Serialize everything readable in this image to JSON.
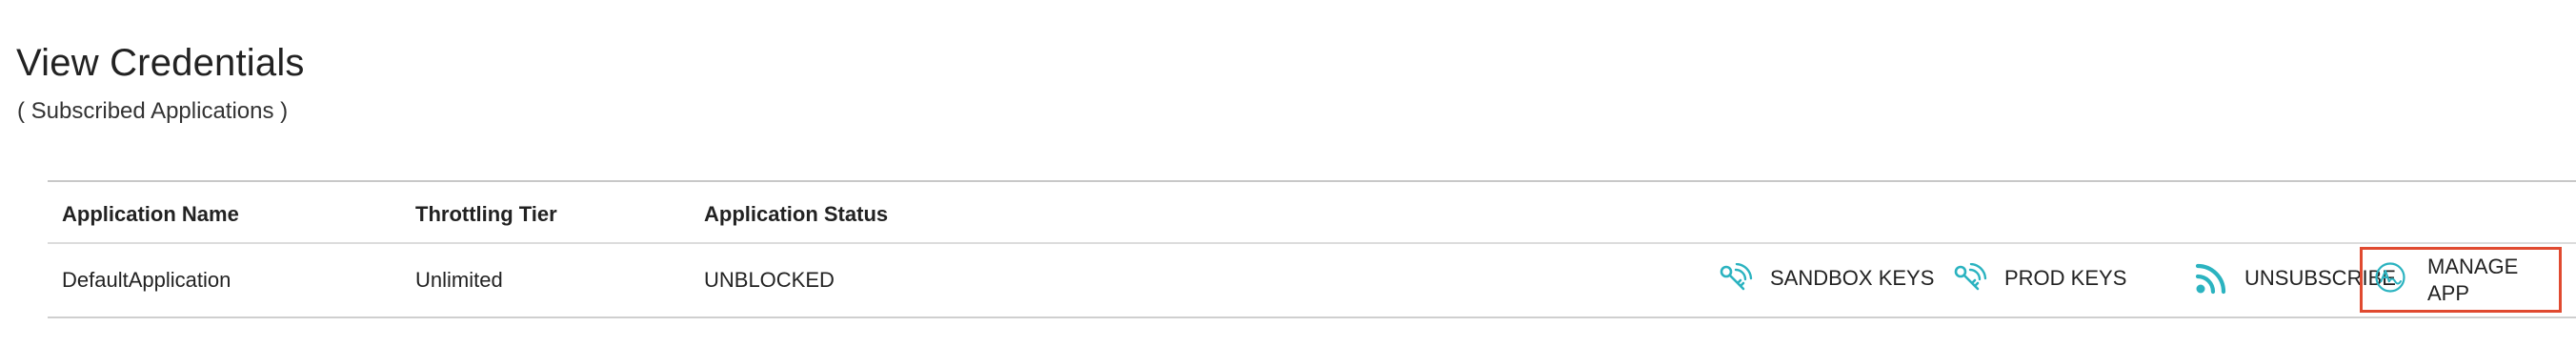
{
  "page": {
    "title": "View Credentials",
    "subtitle": "( Subscribed Applications )"
  },
  "table": {
    "headers": {
      "app_name": "Application Name",
      "tier": "Throttling Tier",
      "status": "Application Status"
    },
    "rows": [
      {
        "app_name": "DefaultApplication",
        "tier": "Unlimited",
        "status": "UNBLOCKED",
        "actions": {
          "sandbox_keys": {
            "label": "SANDBOX KEYS",
            "icon": "key-wave-icon"
          },
          "prod_keys": {
            "label": "PROD KEYS",
            "icon": "key-wave-icon"
          },
          "unsubscribe": {
            "label": "UNSUBSCRIBE",
            "icon": "rss-icon"
          },
          "manage_app": {
            "label": "MANAGE APP",
            "icon": "app-circle-icon"
          }
        }
      }
    ]
  },
  "colors": {
    "icon_teal": "#2bb3c0",
    "highlight_red": "#e04a30",
    "divider": "#c8c8c8"
  }
}
